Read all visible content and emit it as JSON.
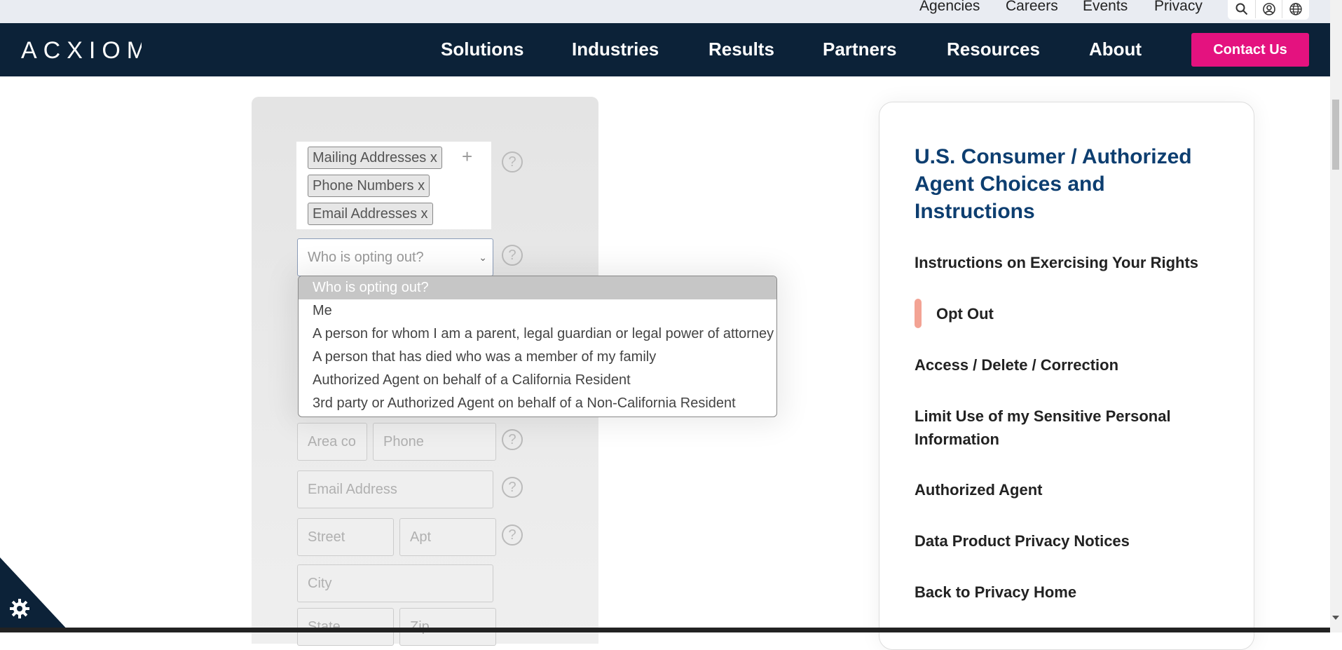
{
  "utility_nav": {
    "links": [
      "Agencies",
      "Careers",
      "Events",
      "Privacy"
    ],
    "icons": [
      "search-icon",
      "account-icon",
      "globe-icon"
    ]
  },
  "main_nav": {
    "logo": "ACXIOM",
    "items": [
      "Solutions",
      "Industries",
      "Results",
      "Partners",
      "Resources",
      "About"
    ],
    "contact_label": "Contact Us",
    "contact_color": "#e4127f",
    "bar_color": "#0c2238"
  },
  "form": {
    "chips": [
      "Mailing Addresses x",
      "Phone Numbers x",
      "Email Addresses x"
    ],
    "add_symbol": "+",
    "help_symbol": "?",
    "who_select": {
      "placeholder": "Who is opting out?",
      "options": [
        "Who is opting out?",
        "Me",
        "A person for whom I am a parent, legal guardian or legal power of attorney",
        "A person that has died who was a member of my family",
        "Authorized Agent on behalf of a California Resident",
        "3rd party or Authorized Agent on behalf of a Non-California Resident"
      ],
      "selected_index": 0
    },
    "fields": {
      "area_code": "Area co",
      "phone": "Phone",
      "email": "Email Address",
      "street": "Street",
      "apt": "Apt",
      "city": "City",
      "state": "State",
      "zip": "Zip"
    }
  },
  "sidebar_card": {
    "title": "U.S. Consumer / Authorized Agent Choices and Instructions",
    "links": [
      "Instructions on Exercising Your Rights",
      "Opt Out",
      "Access / Delete / Correction",
      "Limit Use of my Sensitive Personal Information",
      "Authorized Agent",
      "Data Product Privacy Notices",
      "Back to Privacy Home"
    ],
    "active_index": 1,
    "title_color": "#0d3e70",
    "active_marker_color": "#f3a394"
  },
  "cookie_settings": {
    "icon": "gear-icon"
  }
}
